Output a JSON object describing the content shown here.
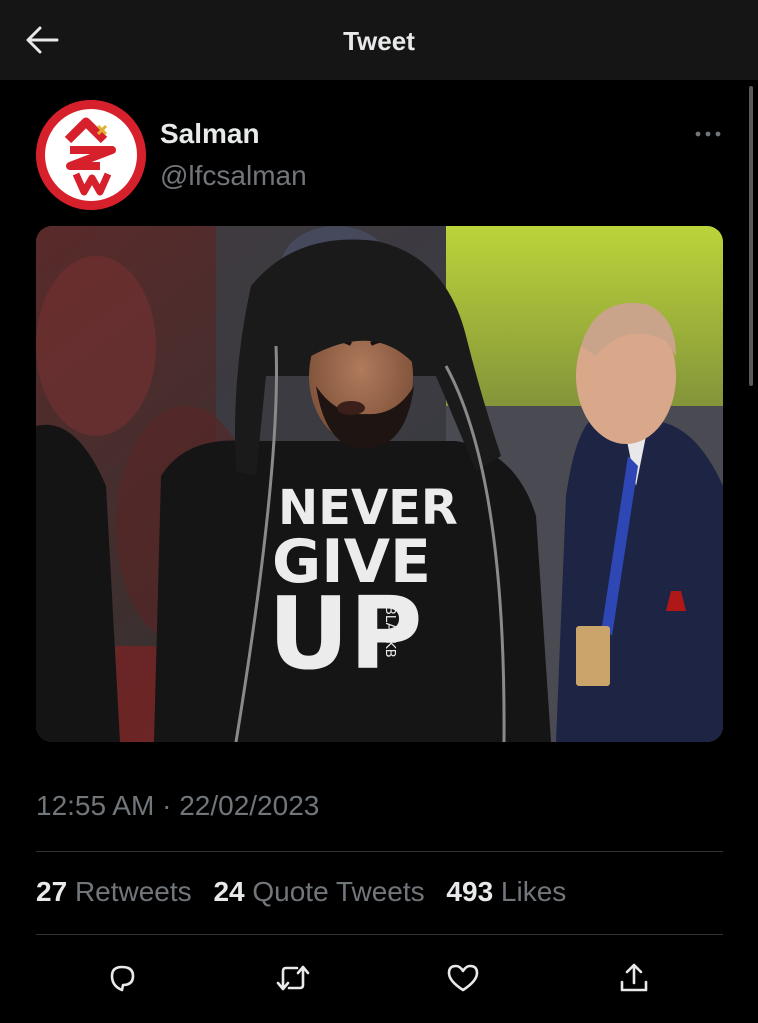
{
  "header": {
    "title": "Tweet",
    "back_icon": "arrow-left-icon"
  },
  "author": {
    "name": "Salman",
    "handle": "@lfcsalman",
    "avatar_color": "#d6202b"
  },
  "menu": {
    "more_icon": "more-horizontal-icon"
  },
  "media": {
    "shirt_text": [
      "NEVER",
      "GIVE",
      "UP"
    ],
    "shirt_brand": "BLACKB"
  },
  "meta": {
    "time": "12:55 AM",
    "separator": "·",
    "date": "22/02/2023"
  },
  "stats": {
    "retweets": {
      "count": "27",
      "label": "Retweets"
    },
    "quote_tweets": {
      "count": "24",
      "label": "Quote Tweets"
    },
    "likes": {
      "count": "493",
      "label": "Likes"
    }
  },
  "actions": [
    {
      "name": "reply",
      "icon": "reply-icon"
    },
    {
      "name": "retweet",
      "icon": "retweet-icon"
    },
    {
      "name": "like",
      "icon": "heart-icon"
    },
    {
      "name": "share",
      "icon": "share-icon"
    }
  ],
  "colors": {
    "background": "#000000",
    "header": "#151515",
    "text": "#e7e9ea",
    "muted": "#71767b"
  }
}
